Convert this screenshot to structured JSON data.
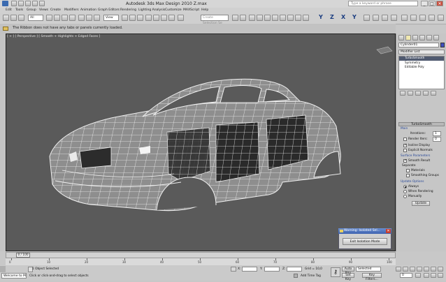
{
  "window": {
    "title": "Autodesk 3ds Max Design 2010      Z.max",
    "search_placeholder": "Type a keyword or phrase",
    "minimize": "_",
    "maximize": "□",
    "close": "✕"
  },
  "menu": [
    "Edit",
    "Tools",
    "Group",
    "Views",
    "Create",
    "Modifiers",
    "Animation",
    "Graph Editors",
    "Rendering",
    "Lighting Analysis",
    "Customize",
    "MAXScript",
    "Help"
  ],
  "toolbar": {
    "filter_value": "All",
    "view_value": "View",
    "selection_set_placeholder": "Create Selection Se",
    "axis_letters": [
      "Y",
      "Z",
      "X",
      "Y"
    ]
  },
  "ribbon": {
    "message": "The Ribbon does not have any tabs or panels currently loaded."
  },
  "viewport": {
    "label": "[ + ] [ Perspective ] [ Smooth + Highlights + Edged Faces ]",
    "background_color": "#5a5a5a"
  },
  "command_panel": {
    "object_name": "Cylinder01",
    "modifier_list": "Modifier List",
    "stack": [
      "TurboSmooth",
      "Symmetry",
      "Editable Poly"
    ],
    "rollout_title": "TurboSmooth",
    "main_group": "Main",
    "iterations_label": "Iterations:",
    "iterations_value": "1",
    "render_iters_label": "Render Iters:",
    "render_iters_value": "0",
    "isoline_display": "Isoline Display",
    "explicit_normals": "Explicit Normals",
    "surface_params_group": "Surface Parameters",
    "smooth_result": "Smooth Result",
    "separate_label": "Separate",
    "materials": "Materials",
    "smoothing_groups": "Smoothing Groups",
    "update_options_group": "Update Options",
    "always": "Always",
    "when_rendering": "When Rendering",
    "manually": "Manually",
    "update_button": "Update"
  },
  "dialog": {
    "title": "Warning: Isolated Sel...",
    "button": "Exit Isolation Mode"
  },
  "timeline": {
    "frame_readout": "0 / 100",
    "ticks": [
      "0",
      "10",
      "20",
      "30",
      "40",
      "50",
      "60",
      "70",
      "80",
      "90",
      "100"
    ]
  },
  "status": {
    "welcome": "Welcome to M",
    "objects_selected": "1 Object Selected",
    "prompt": "Click or click-and-drag to select objects",
    "x_label": "X:",
    "y_label": "Y:",
    "z_label": "Z:",
    "grid": "Grid = 10,0",
    "add_time_tag": "Add Time Tag",
    "auto_key": "Auto Key",
    "set_key": "Set Key",
    "selected": "Selected",
    "key_filters": "Key Filters...",
    "frame_value": "0"
  }
}
